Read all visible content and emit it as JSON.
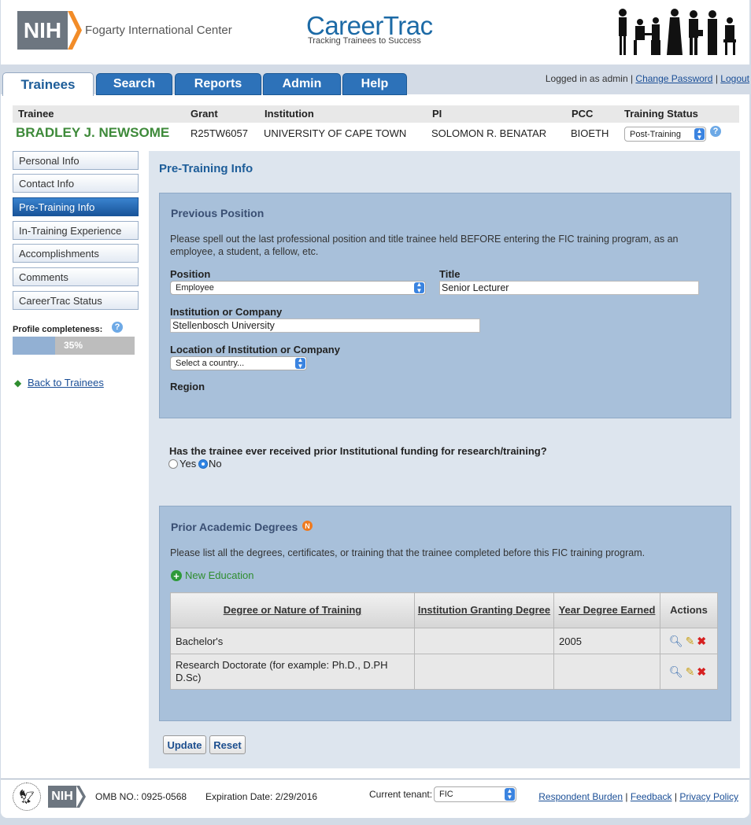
{
  "header": {
    "nih_logo": "NIH",
    "org_name": "Fogarty International Center",
    "app_title": "CareerTrac",
    "app_subtitle": "Tracking Trainees to Success"
  },
  "tabs": [
    {
      "label": "Trainees",
      "active": true
    },
    {
      "label": "Search",
      "active": false
    },
    {
      "label": "Reports",
      "active": false
    },
    {
      "label": "Admin",
      "active": false
    },
    {
      "label": "Help",
      "active": false
    }
  ],
  "login": {
    "text": "Logged in as admin |",
    "change_password": "Change Password",
    "separator": "|",
    "logout": "Logout"
  },
  "trainee_grid": {
    "headers": {
      "trainee": "Trainee",
      "grant": "Grant",
      "institution": "Institution",
      "pi": "PI",
      "pcc": "PCC",
      "status": "Training Status"
    },
    "row": {
      "name": "BRADLEY J. NEWSOME",
      "grant": "R25TW6057",
      "institution": "UNIVERSITY OF CAPE TOWN",
      "pi": "SOLOMON R. BENATAR",
      "pcc": "BIOETH",
      "status": "Post-Training"
    }
  },
  "sidebar": {
    "items": [
      {
        "label": "Personal Info"
      },
      {
        "label": "Contact Info"
      },
      {
        "label": "Pre-Training Info",
        "active": true
      },
      {
        "label": "In-Training Experience"
      },
      {
        "label": "Accomplishments"
      },
      {
        "label": "Comments"
      },
      {
        "label": "CareerTrac Status"
      }
    ],
    "profile_label": "Profile completeness:",
    "profile_value": "35%",
    "profile_fraction": 0.35,
    "back_link": "Back to Trainees"
  },
  "main": {
    "title": "Pre-Training Info",
    "previous_position": {
      "title": "Previous Position",
      "description": "Please spell out the last professional position and title trainee held BEFORE entering the FIC training program, as an employee, a student, a fellow, etc.",
      "position_label": "Position",
      "position_value": "Employee",
      "title_label": "Title",
      "title_value": "Senior Lecturer",
      "institution_label": "Institution or Company",
      "institution_value": "Stellenbosch University",
      "location_label": "Location of Institution or Company",
      "location_value": "Select a country...",
      "region_label": "Region"
    },
    "funding": {
      "question": "Has the trainee ever received prior Institutional funding for research/training?",
      "yes": "Yes",
      "no": "No",
      "selected": "No"
    },
    "degrees": {
      "title": "Prior Academic Degrees",
      "badge": "N",
      "description": "Please list all the degrees, certificates, or training that the trainee completed before this FIC training program.",
      "new_link": "New Education",
      "columns": [
        "Degree or Nature of Training",
        "Institution Granting Degree",
        "Year Degree Earned",
        "Actions"
      ],
      "rows": [
        {
          "degree": "Bachelor's",
          "institution": "",
          "year": "2005"
        },
        {
          "degree": "Research Doctorate (for example: Ph.D., D.PH D.Sc)",
          "institution": "",
          "year": ""
        }
      ]
    },
    "buttons": {
      "update": "Update",
      "reset": "Reset"
    }
  },
  "footer": {
    "nih": "NIH",
    "omb": "OMB NO.: 0925-0568",
    "expiration": "Expiration Date: 2/29/2016",
    "tenant_label": "Current tenant:",
    "tenant_value": "FIC",
    "links": [
      "Respondent Burden",
      "Feedback",
      "Privacy Policy"
    ]
  },
  "colors": {
    "accent": "#2d72b9",
    "trainee_name": "#3e8a3a",
    "panel": "#a8c0da"
  }
}
